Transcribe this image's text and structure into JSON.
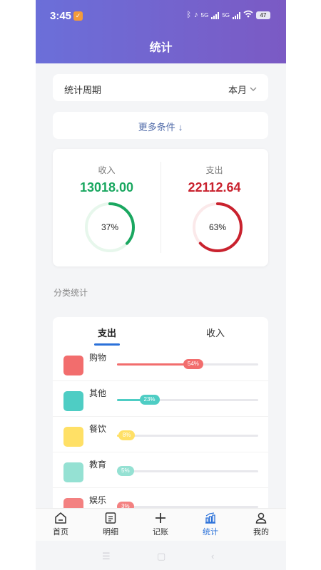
{
  "status_bar": {
    "time": "3:45",
    "network_1": "5G",
    "network_2": "5G",
    "battery": "47"
  },
  "header": {
    "title": "统计"
  },
  "period": {
    "label": "统计周期",
    "value": "本月"
  },
  "more_filters": {
    "label": "更多条件",
    "arrow": "↓"
  },
  "summary": {
    "income": {
      "label": "收入",
      "amount": "13018.00",
      "percent_label": "37%",
      "percent": 0.37,
      "color": "#1aa760"
    },
    "expense": {
      "label": "支出",
      "amount": "22112.64",
      "percent_label": "63%",
      "percent": 0.63,
      "color": "#c9222e"
    }
  },
  "category_section": {
    "title": "分类统计"
  },
  "category_tabs": {
    "expense": "支出",
    "income": "收入",
    "active": "expense"
  },
  "categories": [
    {
      "name": "购物",
      "percent_label": "54%",
      "percent": 0.54,
      "color": "#f26d6d"
    },
    {
      "name": "其他",
      "percent_label": "23%",
      "percent": 0.23,
      "color": "#4ecdc4"
    },
    {
      "name": "餐饮",
      "percent_label": "8%",
      "percent": 0.08,
      "color": "#ffe066"
    },
    {
      "name": "教育",
      "percent_label": "5%",
      "percent": 0.05,
      "color": "#95e1d3"
    },
    {
      "name": "娱乐",
      "percent_label": "3%",
      "percent": 0.03,
      "color": "#f38181"
    }
  ],
  "nav": {
    "items": [
      {
        "label": "首页",
        "icon": "home-icon"
      },
      {
        "label": "明细",
        "icon": "list-icon"
      },
      {
        "label": "记账",
        "icon": "plus-icon"
      },
      {
        "label": "统计",
        "icon": "stats-icon",
        "active": true
      },
      {
        "label": "我的",
        "icon": "profile-icon"
      }
    ]
  }
}
